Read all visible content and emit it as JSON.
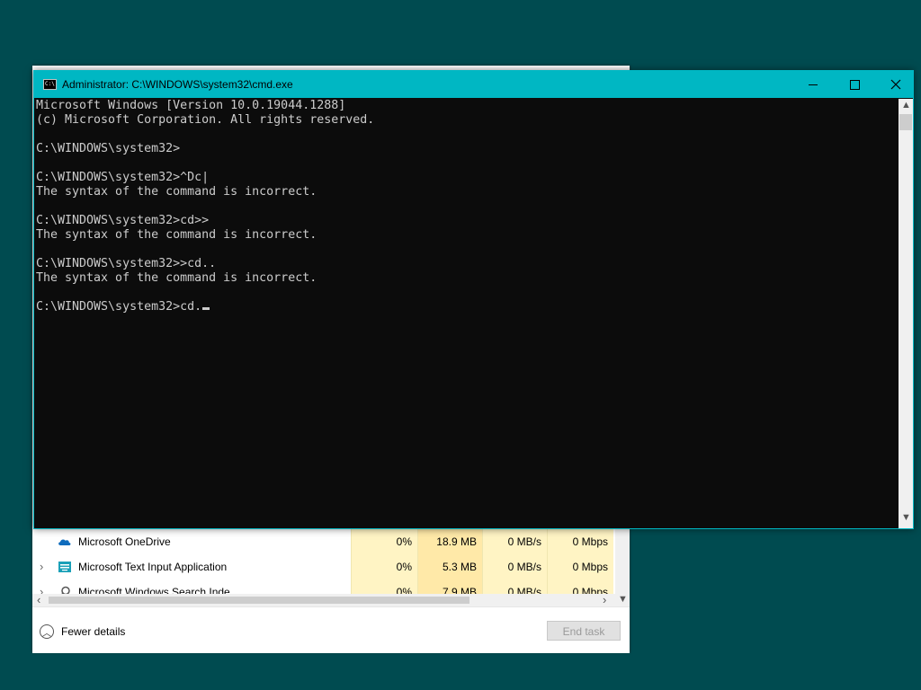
{
  "taskmgr": {
    "rows": [
      {
        "name": "Microsoft OneDrive",
        "cpu": "0%",
        "memory": "18.9 MB",
        "disk": "0 MB/s",
        "network": "0 Mbps",
        "expandable": false,
        "icon": "onedrive-cloud-icon"
      },
      {
        "name": "Microsoft Text Input Application",
        "cpu": "0%",
        "memory": "5.3 MB",
        "disk": "0 MB/s",
        "network": "0 Mbps",
        "expandable": true,
        "icon": "text-input-app-icon"
      },
      {
        "name": "Microsoft Windows Search Inde...",
        "cpu": "0%",
        "memory": "7.9 MB",
        "disk": "0 MB/s",
        "network": "0 Mbps",
        "expandable": true,
        "icon": "search-indexer-icon"
      }
    ],
    "fewer_details_label": "Fewer details",
    "end_task_label": "End task"
  },
  "cmd": {
    "title": "Administrator: C:\\WINDOWS\\system32\\cmd.exe",
    "lines": [
      "Microsoft Windows [Version 10.0.19044.1288]",
      "(c) Microsoft Corporation. All rights reserved.",
      "",
      "C:\\WINDOWS\\system32>",
      "",
      "C:\\WINDOWS\\system32>^Dc|",
      "The syntax of the command is incorrect.",
      "",
      "C:\\WINDOWS\\system32>cd>>",
      "The syntax of the command is incorrect.",
      "",
      "C:\\WINDOWS\\system32>>cd..",
      "The syntax of the command is incorrect.",
      "",
      "C:\\WINDOWS\\system32>cd."
    ],
    "caption_buttons": {
      "minimize": "minimize-icon",
      "maximize": "maximize-icon",
      "close": "close-icon"
    }
  },
  "colors": {
    "desktop": "#004b50",
    "titlebar": "#00b7c3",
    "console_bg": "#0c0c0c",
    "console_text": "#cccccc",
    "taskmgr_highlight": "#fff4c4"
  }
}
